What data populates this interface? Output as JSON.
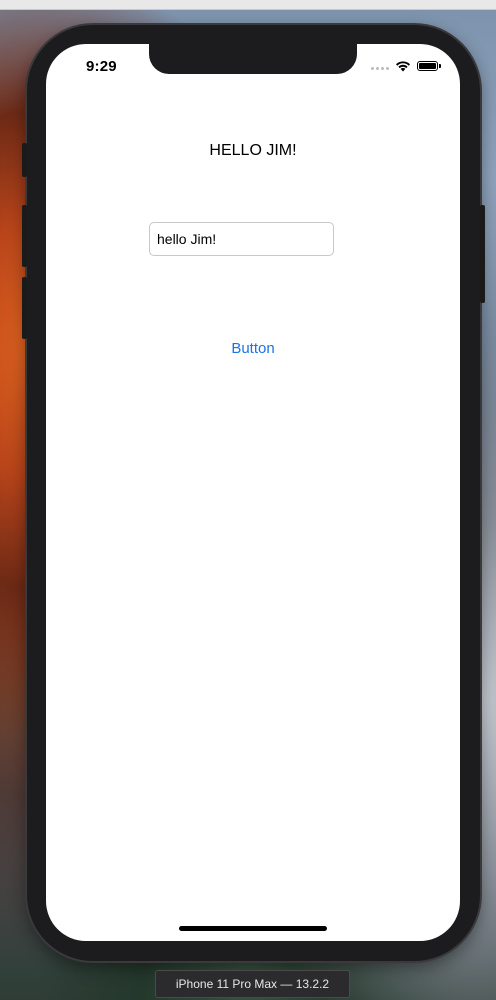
{
  "status_bar": {
    "time": "9:29"
  },
  "icons": {
    "signal": "signal-dots-icon",
    "wifi": "wifi-icon",
    "battery": "battery-icon"
  },
  "main": {
    "greeting_label": "HELLO JIM!",
    "text_field": {
      "value": "hello Jim!"
    },
    "button_label": "Button"
  },
  "simulator": {
    "device_label": "iPhone 11 Pro Max — 13.2.2"
  },
  "colors": {
    "button_tint": "#1a73e8",
    "screen_background": "#ffffff",
    "device_frame": "#1c1c1e"
  }
}
